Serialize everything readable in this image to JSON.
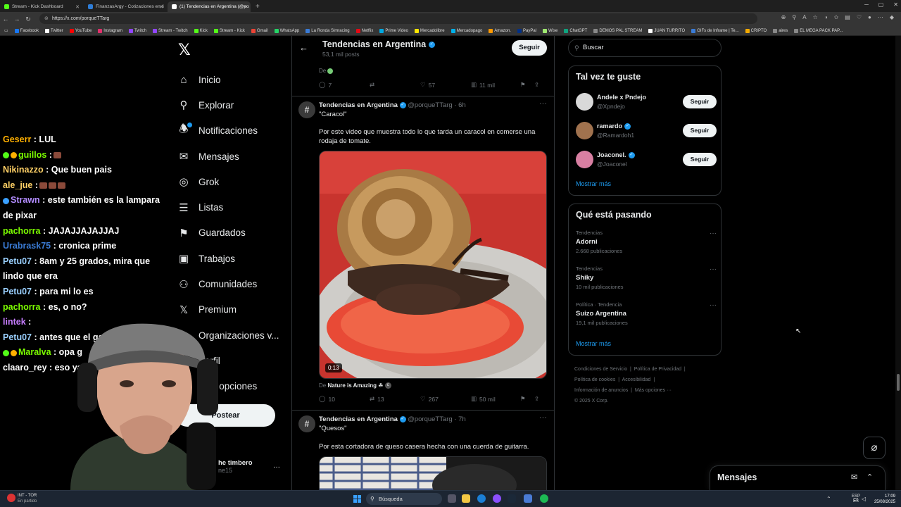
{
  "browser": {
    "tabs": [
      {
        "title": "Stream - Kick Dashboard",
        "color": "#53fc18",
        "active": false
      },
      {
        "title": "FinanzasArgy - Cotizaciones en ti",
        "color": "#2e7dd7",
        "active": false
      },
      {
        "title": "(1) Tendencias en Argentina (@po",
        "color": "#ffffff",
        "active": true
      }
    ],
    "url": "https://x.com/porqueTTarg",
    "bookmarks": [
      {
        "label": "Facebook",
        "color": "#1877f2"
      },
      {
        "label": "Twitter",
        "color": "#ffffff"
      },
      {
        "label": "YouTube",
        "color": "#ff0000"
      },
      {
        "label": "Instagram",
        "color": "#e1306c"
      },
      {
        "label": "Twitch",
        "color": "#9146ff"
      },
      {
        "label": "Stream - Twitch",
        "color": "#9146ff"
      },
      {
        "label": "Kick",
        "color": "#53fc18"
      },
      {
        "label": "Stream - Kick",
        "color": "#53fc18"
      },
      {
        "label": "Gmail",
        "color": "#ea4335"
      },
      {
        "label": "WhatsApp",
        "color": "#25d366"
      },
      {
        "label": "La Ronda Simracing",
        "color": "#3a7bd5"
      },
      {
        "label": "Netflix",
        "color": "#e50914"
      },
      {
        "label": "Prime Video",
        "color": "#00a8e1"
      },
      {
        "label": "Mercadolibre",
        "color": "#ffe600"
      },
      {
        "label": "Mercadopago",
        "color": "#00b1ea"
      },
      {
        "label": "Amazon.",
        "color": "#ff9900"
      },
      {
        "label": "PayPal",
        "color": "#003087"
      },
      {
        "label": "Wise",
        "color": "#9fe870"
      },
      {
        "label": "ChatGPT",
        "color": "#10a37f"
      },
      {
        "label": "DEMOS PAL STREAM",
        "color": "#888888"
      },
      {
        "label": "JUAN TURRITO",
        "color": "#ffffff"
      },
      {
        "label": "GIFs de Inframe | Te...",
        "color": "#3a7bd5"
      },
      {
        "label": "CRIPTO",
        "color": "#f2a900"
      },
      {
        "label": "aires",
        "color": "#888888"
      },
      {
        "label": "EL MEGA PACK PAP...",
        "color": "#888888"
      }
    ]
  },
  "chat": [
    {
      "user": "Geserr",
      "color": "#ffb000",
      "text": ": LUL",
      "badges": [],
      "emotes": 0
    },
    {
      "user": "guillos",
      "color": "#7cfc00",
      "text": ":",
      "badges": [
        "#53fc18",
        "#ffb000"
      ],
      "emotes": 1
    },
    {
      "user": "Nikinazzo",
      "color": "#ffd166",
      "text": ": Que buen pais",
      "badges": [],
      "emotes": 0
    },
    {
      "user": "ale_jue",
      "color": "#ffd166",
      "text": ":",
      "badges": [],
      "emotes": 3
    },
    {
      "user": "Strawn",
      "color": "#b28cff",
      "text": ": este también es la lampara de pixar",
      "badges": [
        "#3aa0ff"
      ],
      "emotes": 0
    },
    {
      "user": "pachorra",
      "color": "#7cfc00",
      "text": ": JAJAJJAJAJJAJ",
      "badges": [],
      "emotes": 0
    },
    {
      "user": "Urabrask75",
      "color": "#3a7bd5",
      "text": ": cronica prime",
      "badges": [],
      "emotes": 0
    },
    {
      "user": "Petu07",
      "color": "#9ad0ff",
      "text": ": 8am y 25 grados, mira que lindo que era",
      "badges": [],
      "emotes": 0
    },
    {
      "user": "Petu07",
      "color": "#9ad0ff",
      "text": ": para mi lo es",
      "badges": [],
      "emotes": 0
    },
    {
      "user": "pachorra",
      "color": "#7cfc00",
      "text": ": es, o no?",
      "badges": [],
      "emotes": 0
    },
    {
      "user": "lintek",
      "color": "#c77dff",
      "text": ":",
      "badges": [],
      "emotes": 0
    },
    {
      "user": "Petu07",
      "color": "#9ad0ff",
      "text": ": antes que el ga",
      "badges": [],
      "emotes": 0
    },
    {
      "user": "Maralva",
      "color": "#7cfc00",
      "text": ": opa g",
      "badges": [
        "#53fc18",
        "#ffb000"
      ],
      "emotes": 0
    },
    {
      "user": "claaro_rey",
      "color": "#ffffff",
      "text": ": eso ya lo jackson",
      "badges": [],
      "emotes": 0
    }
  ],
  "nav": {
    "items": [
      {
        "label": "Inicio",
        "icon": "home-icon",
        "glyph": "⌂"
      },
      {
        "label": "Explorar",
        "icon": "search-icon",
        "glyph": "⚲"
      },
      {
        "label": "Notificaciones",
        "icon": "bell-icon",
        "glyph": "🔔"
      },
      {
        "label": "Mensajes",
        "icon": "mail-icon",
        "glyph": "✉"
      },
      {
        "label": "Grok",
        "icon": "grok-icon",
        "glyph": "◎"
      },
      {
        "label": "Listas",
        "icon": "list-icon",
        "glyph": "☰"
      },
      {
        "label": "Guardados",
        "icon": "bookmark-icon",
        "glyph": "⚑"
      },
      {
        "label": "Trabajos",
        "icon": "briefcase-icon",
        "glyph": "▣"
      },
      {
        "label": "Comunidades",
        "icon": "communities-icon",
        "glyph": "⚇"
      },
      {
        "label": "Premium",
        "icon": "x-premium-icon",
        "glyph": "𝕏"
      },
      {
        "label": "Organizaciones v...",
        "icon": "lightning-icon",
        "glyph": "ϟ"
      },
      {
        "label": "Perfil",
        "icon": "profile-icon",
        "glyph": "☺"
      },
      {
        "label": "Más opciones",
        "icon": "more-circle-icon",
        "glyph": "⋯"
      }
    ],
    "post_label": "Postear",
    "account_name": "he timbero",
    "account_handle": "ne15"
  },
  "feed_header": {
    "title": "Tendencias en Argentina",
    "subtitle": "53,1 mil posts",
    "follow_label": "Seguir"
  },
  "tweets": [
    {
      "credit_prefix": "De",
      "replies": "7",
      "retweets": "",
      "likes": "57",
      "views": "11 mil"
    },
    {
      "name": "Tendencias en Argentina",
      "handle": "@porqueTTarg",
      "time": "· 6h",
      "quote": "\"Caracol\"",
      "text": "Por este video que muestra todo lo que tarda un caracol en comerse una rodaja de tomate.",
      "duration": "0:13",
      "credit_prefix": "De",
      "credit_name": "Nature is Amazing ☘",
      "replies": "10",
      "retweets": "13",
      "likes": "267",
      "views": "50 mil"
    },
    {
      "name": "Tendencias en Argentina",
      "handle": "@porqueTTarg",
      "time": "· 7h",
      "quote": "\"Quesos\"",
      "text": "Por esta cortadora de queso casera hecha con una cuerda de guitarra."
    }
  ],
  "sidebar": {
    "search_placeholder": "Buscar",
    "suggestions_title": "Tal vez te guste",
    "suggestions": [
      {
        "name": "Andele x Pndejo",
        "handle": "@Xpndejo",
        "button": "Seguir",
        "avatar": "#d9d9d9",
        "verified": false
      },
      {
        "name": "ramardo",
        "handle": "@Ramardoh1",
        "button": "Seguir",
        "avatar": "#a0724e",
        "verified": true
      },
      {
        "name": "Joaconel.",
        "handle": "@Joaconel",
        "button": "Seguir",
        "avatar": "#d87fa2",
        "verified": true
      }
    ],
    "show_more": "Mostrar más",
    "trends_title": "Qué está pasando",
    "trends": [
      {
        "context": "Tendencias",
        "topic": "Adorni",
        "posts": "2.668 publicaciones"
      },
      {
        "context": "Tendencias",
        "topic": "Shiky",
        "posts": "10 mil publicaciones"
      },
      {
        "context": "Política · Tendencia",
        "topic": "Suizo Argentina",
        "posts": "19,1 mil publicaciones"
      }
    ],
    "trends_show_more": "Mostrar más",
    "footer": {
      "terms": "Condiciones de Servicio",
      "privacy": "Política de Privacidad",
      "cookies": "Política de cookies",
      "accessibility": "Accesibilidad",
      "ads": "Información de anuncios",
      "more": "Más opciones ···",
      "copyright": "© 2025 X Corp."
    }
  },
  "messages_drawer": {
    "title": "Mensajes"
  },
  "taskbar": {
    "left_line1": "INT - TOR",
    "left_line2": "En partido",
    "search": "Búsqueda",
    "lang1": "ESP",
    "lang2": "ES",
    "time": "17:09",
    "date": "25/08/2025"
  }
}
